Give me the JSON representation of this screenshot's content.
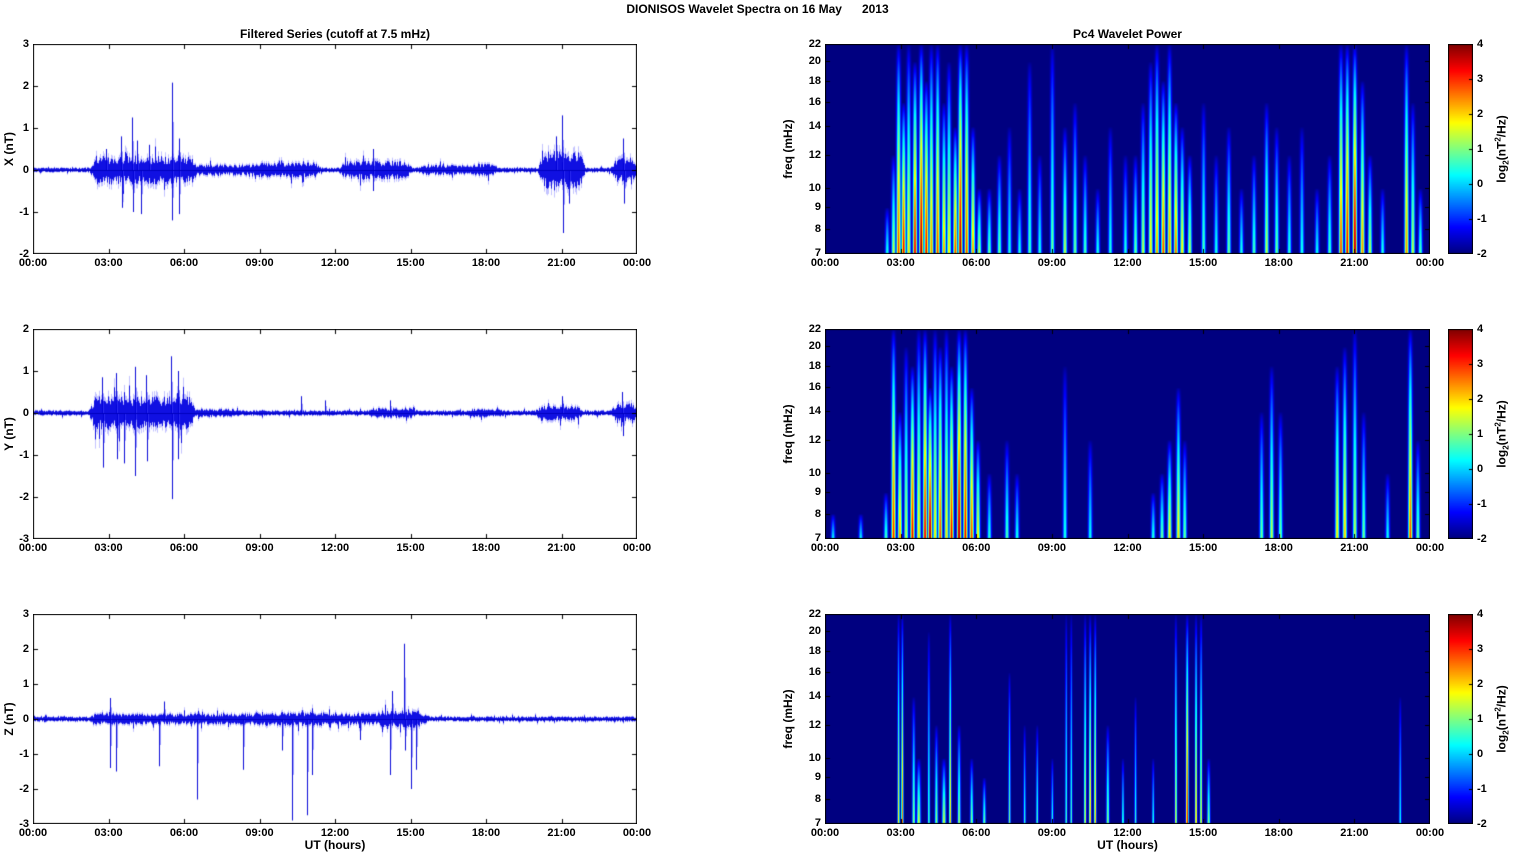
{
  "figure_title": "DIONISOS Wavelet Spectra on 16 May      2013",
  "axes": {
    "time_ticks": [
      "00:00",
      "03:00",
      "06:00",
      "09:00",
      "12:00",
      "15:00",
      "18:00",
      "21:00",
      "00:00"
    ],
    "time_hours": [
      0,
      3,
      6,
      9,
      12,
      15,
      18,
      21,
      24
    ],
    "xlabel": "UT (hours)"
  },
  "colorbar": {
    "ticks": [
      4,
      3,
      2,
      1,
      0,
      -1,
      -2
    ],
    "range": [
      -2,
      4
    ],
    "label_parts": {
      "pre": "log",
      "sub": "2",
      "mid": "(nT",
      "sup": "2",
      "post": "/Hz)"
    }
  },
  "colors": {
    "trace": "#0000E0",
    "trace_halo": "#5555FF",
    "spectrogram_bg": "#00008F",
    "axis": "#000000"
  },
  "chart_data": [
    {
      "id": "ts_x",
      "type": "line",
      "title": "Filtered Series (cutoff at 7.5 mHz)",
      "ylabel": "X (nT)",
      "ylim": [
        -2,
        3
      ],
      "yticks": [
        3,
        2,
        1,
        0,
        -1,
        -2
      ],
      "noise": 0.055,
      "bursts": [
        [
          2.5,
          6.3,
          0.35
        ],
        [
          6.3,
          9.0,
          0.13
        ],
        [
          9.0,
          11.2,
          0.18
        ],
        [
          12.4,
          14.8,
          0.22
        ],
        [
          15.5,
          17.3,
          0.12
        ],
        [
          17.5,
          18.2,
          0.15
        ],
        [
          20.3,
          21.7,
          0.45
        ],
        [
          23.2,
          23.8,
          0.3
        ]
      ],
      "spikes": [
        [
          2.9,
          0.5
        ],
        [
          3.5,
          0.8
        ],
        [
          3.52,
          -0.9
        ],
        [
          3.95,
          1.25
        ],
        [
          3.97,
          -1.0
        ],
        [
          4.15,
          0.7
        ],
        [
          4.3,
          -1.05
        ],
        [
          4.6,
          0.6
        ],
        [
          5.52,
          2.08
        ],
        [
          5.54,
          -1.2
        ],
        [
          5.8,
          0.75
        ],
        [
          5.82,
          -1.05
        ],
        [
          13.5,
          0.5
        ],
        [
          13.52,
          -0.5
        ],
        [
          20.8,
          0.8
        ],
        [
          21.0,
          1.3
        ],
        [
          21.05,
          -1.5
        ],
        [
          21.3,
          -0.8
        ],
        [
          23.45,
          0.75
        ],
        [
          23.5,
          -0.8
        ]
      ]
    },
    {
      "id": "ts_y",
      "type": "line",
      "title": "Filtered Series (cutoff at 7.5 mHz)",
      "ylabel": "Y (nT)",
      "ylim": [
        -3,
        2
      ],
      "yticks": [
        2,
        1,
        0,
        -1,
        -2,
        -3
      ],
      "noise": 0.06,
      "bursts": [
        [
          2.45,
          6.2,
          0.4
        ],
        [
          6.2,
          8.0,
          0.1
        ],
        [
          13.5,
          15.0,
          0.12
        ],
        [
          17.5,
          18.5,
          0.1
        ],
        [
          20.2,
          21.6,
          0.18
        ],
        [
          23.2,
          23.8,
          0.25
        ]
      ],
      "spikes": [
        [
          2.75,
          0.85
        ],
        [
          2.77,
          -1.3
        ],
        [
          3.3,
          0.95
        ],
        [
          3.32,
          -1.1
        ],
        [
          3.6,
          -1.2
        ],
        [
          4.05,
          1.1
        ],
        [
          4.07,
          -1.5
        ],
        [
          4.5,
          0.9
        ],
        [
          4.52,
          -1.15
        ],
        [
          5.5,
          1.35
        ],
        [
          5.53,
          -2.05
        ],
        [
          5.75,
          1.0
        ],
        [
          5.77,
          -1.1
        ],
        [
          10.65,
          0.4
        ],
        [
          11.6,
          0.3
        ],
        [
          14.2,
          0.3
        ],
        [
          21.0,
          0.4
        ],
        [
          23.4,
          0.5
        ],
        [
          23.45,
          -0.55
        ]
      ]
    },
    {
      "id": "ts_z",
      "type": "line",
      "title": "Filtered Series (cutoff at 7.5 mHz)",
      "ylabel": "Z (nT)",
      "ylim": [
        -3,
        3
      ],
      "yticks": [
        3,
        2,
        1,
        0,
        -1,
        -2,
        -3
      ],
      "noise": 0.07,
      "bursts": [
        [
          2.5,
          15.5,
          0.16
        ],
        [
          8.8,
          11.5,
          0.2
        ],
        [
          13.8,
          15.3,
          0.25
        ]
      ],
      "spikes": [
        [
          3.05,
          0.6
        ],
        [
          3.07,
          -1.4
        ],
        [
          3.3,
          -1.5
        ],
        [
          5.0,
          -1.35
        ],
        [
          5.2,
          0.5
        ],
        [
          6.5,
          -2.3
        ],
        [
          8.35,
          -1.45
        ],
        [
          9.9,
          -0.9
        ],
        [
          10.3,
          -2.9
        ],
        [
          10.9,
          -2.75
        ],
        [
          11.1,
          -1.6
        ],
        [
          13.0,
          -0.6
        ],
        [
          14.2,
          -1.6
        ],
        [
          14.25,
          0.8
        ],
        [
          14.75,
          2.15
        ],
        [
          14.8,
          -0.9
        ],
        [
          15.0,
          -2.0
        ],
        [
          15.2,
          -1.45
        ]
      ]
    },
    {
      "id": "wav_x",
      "type": "heatmap",
      "title": "Pc4 Wavelet Power",
      "ylabel": "freq (mHz)",
      "yticks": [
        22,
        20,
        18,
        16,
        14,
        12,
        10,
        9,
        8,
        7
      ],
      "flim": [
        7,
        22
      ],
      "clim": [
        -2,
        4
      ],
      "streaks": [
        [
          2.45,
          9,
          0.5
        ],
        [
          2.7,
          12,
          1.5
        ],
        [
          2.9,
          22,
          3
        ],
        [
          3.1,
          16,
          3.5
        ],
        [
          3.3,
          22,
          2
        ],
        [
          3.55,
          20,
          3.5
        ],
        [
          3.8,
          22,
          4
        ],
        [
          4.0,
          18,
          3.5
        ],
        [
          4.2,
          22,
          2.5
        ],
        [
          4.45,
          22,
          3
        ],
        [
          4.7,
          16,
          2.5
        ],
        [
          4.9,
          20,
          2
        ],
        [
          5.15,
          14,
          3
        ],
        [
          5.35,
          22,
          4
        ],
        [
          5.6,
          22,
          3
        ],
        [
          5.85,
          14,
          2.5
        ],
        [
          6.1,
          10,
          1.5
        ],
        [
          6.5,
          10,
          1
        ],
        [
          6.9,
          12,
          1
        ],
        [
          7.3,
          14,
          0.5
        ],
        [
          7.7,
          10,
          0.5
        ],
        [
          8.1,
          20,
          0.8
        ],
        [
          8.5,
          12,
          0.5
        ],
        [
          9.0,
          22,
          1
        ],
        [
          9.5,
          14,
          1.5
        ],
        [
          9.9,
          16,
          1
        ],
        [
          10.3,
          12,
          0.8
        ],
        [
          10.8,
          10,
          0.5
        ],
        [
          11.3,
          14,
          0.5
        ],
        [
          11.9,
          12,
          0.5
        ],
        [
          12.3,
          12,
          1
        ],
        [
          12.6,
          16,
          1.5
        ],
        [
          12.9,
          20,
          2
        ],
        [
          13.15,
          22,
          2.5
        ],
        [
          13.4,
          18,
          3
        ],
        [
          13.65,
          22,
          2.5
        ],
        [
          13.9,
          16,
          2.8
        ],
        [
          14.15,
          14,
          2
        ],
        [
          14.45,
          12,
          1.5
        ],
        [
          15.0,
          16,
          0.8
        ],
        [
          15.5,
          12,
          0.5
        ],
        [
          16.0,
          14,
          1
        ],
        [
          16.5,
          10,
          0.5
        ],
        [
          17.0,
          12,
          0.8
        ],
        [
          17.5,
          16,
          1.5
        ],
        [
          17.9,
          14,
          1
        ],
        [
          18.4,
          12,
          0.6
        ],
        [
          18.9,
          14,
          0.5
        ],
        [
          19.5,
          10,
          0.4
        ],
        [
          20.0,
          12,
          0.8
        ],
        [
          20.45,
          22,
          3
        ],
        [
          20.7,
          22,
          3.5
        ],
        [
          21.0,
          22,
          4
        ],
        [
          21.3,
          18,
          2.5
        ],
        [
          21.6,
          12,
          1.5
        ],
        [
          22.1,
          10,
          0.5
        ],
        [
          23.05,
          22,
          2.5
        ],
        [
          23.3,
          16,
          1.5
        ],
        [
          23.6,
          10,
          0.8
        ]
      ]
    },
    {
      "id": "wav_y",
      "type": "heatmap",
      "title": "Pc4 Wavelet Power",
      "ylabel": "freq (mHz)",
      "yticks": [
        22,
        20,
        18,
        16,
        14,
        12,
        10,
        9,
        8,
        7
      ],
      "flim": [
        7,
        22
      ],
      "clim": [
        -2,
        4
      ],
      "streaks": [
        [
          0.3,
          8,
          0.3
        ],
        [
          1.4,
          8,
          0.3
        ],
        [
          2.4,
          9,
          0.8
        ],
        [
          2.7,
          22,
          3.2
        ],
        [
          2.95,
          14,
          2.5
        ],
        [
          3.2,
          20,
          1.5
        ],
        [
          3.45,
          18,
          3.5
        ],
        [
          3.7,
          22,
          2
        ],
        [
          3.95,
          22,
          3.5
        ],
        [
          4.15,
          16,
          4
        ],
        [
          4.35,
          22,
          2
        ],
        [
          4.55,
          20,
          3
        ],
        [
          4.8,
          22,
          2
        ],
        [
          5.0,
          18,
          3.5
        ],
        [
          5.3,
          22,
          4
        ],
        [
          5.55,
          22,
          3.5
        ],
        [
          5.8,
          16,
          3
        ],
        [
          6.05,
          12,
          2
        ],
        [
          6.5,
          10,
          0.6
        ],
        [
          7.2,
          12,
          0.8
        ],
        [
          7.6,
          10,
          0.5
        ],
        [
          9.5,
          18,
          0.5
        ],
        [
          10.5,
          12,
          0.4
        ],
        [
          13.0,
          9,
          0.6
        ],
        [
          13.35,
          10,
          1
        ],
        [
          13.65,
          12,
          2
        ],
        [
          14.0,
          16,
          2
        ],
        [
          14.25,
          12,
          1
        ],
        [
          17.3,
          14,
          1
        ],
        [
          17.7,
          18,
          1.5
        ],
        [
          18.05,
          14,
          1
        ],
        [
          20.3,
          18,
          2
        ],
        [
          20.6,
          20,
          2.2
        ],
        [
          21.0,
          22,
          1.5
        ],
        [
          21.35,
          14,
          1
        ],
        [
          22.3,
          10,
          0.4
        ],
        [
          23.2,
          22,
          3
        ],
        [
          23.5,
          12,
          1
        ]
      ]
    },
    {
      "id": "wav_z",
      "type": "heatmap",
      "title": "Pc4 Wavelet Power",
      "ylabel": "freq (mHz)",
      "yticks": [
        22,
        20,
        18,
        16,
        14,
        12,
        10,
        9,
        8,
        7
      ],
      "flim": [
        7,
        22
      ],
      "clim": [
        -2,
        4
      ],
      "streaks": [
        [
          2.9,
          22,
          1.8,
          0.03
        ],
        [
          3.05,
          22,
          2.6,
          0.03
        ],
        [
          3.5,
          14,
          1.2,
          0.04
        ],
        [
          3.7,
          10,
          1.6,
          0.05
        ],
        [
          4.1,
          20,
          0.8,
          0.03
        ],
        [
          4.4,
          12,
          1.2,
          0.04
        ],
        [
          4.7,
          10,
          1.6,
          0.05
        ],
        [
          4.95,
          22,
          2.2,
          0.03
        ],
        [
          5.3,
          12,
          1.4,
          0.04
        ],
        [
          5.8,
          10,
          1.2,
          0.04
        ],
        [
          6.3,
          9,
          1.0,
          0.04
        ],
        [
          7.3,
          16,
          1.0,
          0.03
        ],
        [
          7.9,
          12,
          0.6,
          0.03
        ],
        [
          8.4,
          12,
          0.8,
          0.03
        ],
        [
          9.0,
          10,
          0.6,
          0.03
        ],
        [
          9.55,
          22,
          0.8,
          0.025
        ],
        [
          9.75,
          22,
          0.8,
          0.025
        ],
        [
          10.3,
          22,
          1.8,
          0.03
        ],
        [
          10.5,
          22,
          2.4,
          0.03
        ],
        [
          10.7,
          22,
          2.3,
          0.03
        ],
        [
          11.2,
          12,
          1.2,
          0.04
        ],
        [
          11.8,
          10,
          0.8,
          0.03
        ],
        [
          12.3,
          14,
          0.6,
          0.03
        ],
        [
          13.0,
          10,
          0.6,
          0.03
        ],
        [
          13.9,
          22,
          1.8,
          0.03
        ],
        [
          14.35,
          22,
          3.4,
          0.035
        ],
        [
          14.7,
          22,
          2.4,
          0.03
        ],
        [
          14.9,
          22,
          1.9,
          0.03
        ],
        [
          15.2,
          10,
          1.2,
          0.04
        ],
        [
          22.8,
          14,
          0.4,
          0.03
        ]
      ]
    }
  ]
}
